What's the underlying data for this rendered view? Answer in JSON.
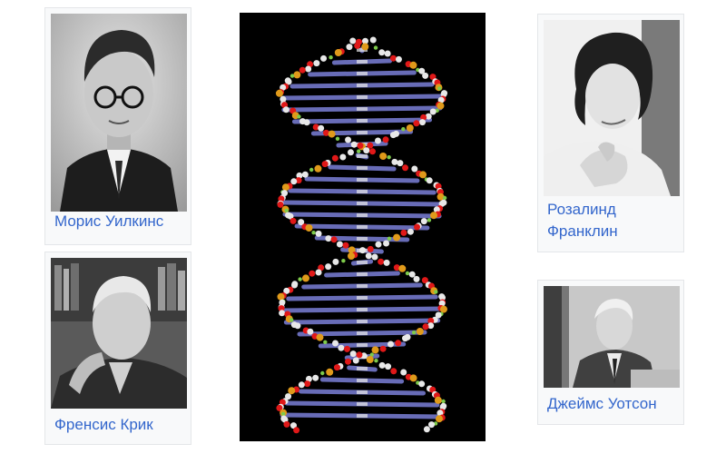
{
  "gallery": {
    "items": [
      {
        "id": "wilkins",
        "caption": "Морис Уилкинс"
      },
      {
        "id": "crick",
        "caption": "Френсис Крик"
      },
      {
        "id": "franklin",
        "caption_line1": "Розалинд",
        "caption_line2": "Франклин"
      },
      {
        "id": "watson",
        "caption": "Джеймс Уотсон"
      }
    ],
    "center_image": "dna-double-helix-model"
  },
  "colors": {
    "link": "#3366cc",
    "card_bg": "#f8f9fa",
    "card_border": "#e4e6e9",
    "dna_bg": "#000000",
    "dna_backbone": "#e8e8e8",
    "dna_oxygen": "#e01818",
    "dna_phosphorus": "#e09a1a",
    "dna_nitrogen": "#7b7fd8",
    "dna_hydrogen": "#7ecb4a"
  }
}
